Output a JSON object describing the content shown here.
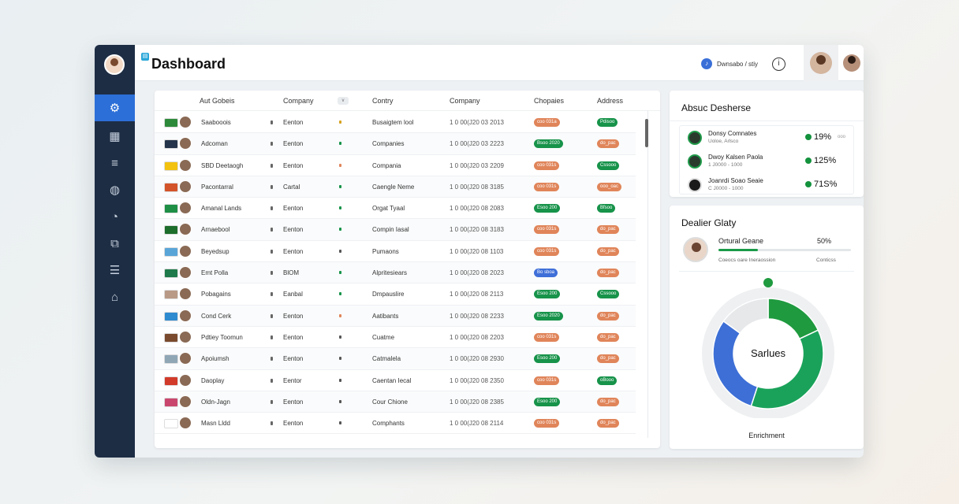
{
  "window": {
    "title": "Dashboard"
  },
  "topbar": {
    "user_label": "Dwnsabo / stiy",
    "info_glyph": "i"
  },
  "sidebar": {
    "items": [
      {
        "icon": "gear-icon",
        "glyph": "⚙",
        "active": true
      },
      {
        "icon": "building-icon",
        "glyph": "▦"
      },
      {
        "icon": "menu-icon",
        "glyph": "≡"
      },
      {
        "icon": "globe-icon",
        "glyph": "◍"
      },
      {
        "icon": "clock-icon",
        "glyph": "◔"
      },
      {
        "icon": "users-icon",
        "glyph": "⧉"
      },
      {
        "icon": "list-icon",
        "glyph": "☰"
      },
      {
        "icon": "home-icon",
        "glyph": "⌂"
      }
    ]
  },
  "table": {
    "headers": [
      "Aut Gobeis",
      "Company",
      "Contry",
      "Company",
      "Chopaies",
      "Address"
    ],
    "header_chip": "v",
    "rows": [
      {
        "name": "Saabooois",
        "company": "Eenton",
        "country": "Busaigtem lool",
        "phone": "1 0 00(J20 03 2013",
        "p1": "coo 031a",
        "p1c": "#e0855a",
        "p2": "Pdisoo",
        "p2c": "#17934a",
        "thumb": "#2d8a3a",
        "dot": "#d6a21f"
      },
      {
        "name": "Adcoman",
        "company": "Eenton",
        "country": "Companies",
        "phone": "1 0 00(J20 03 2223",
        "p1": "Bsoo 2020",
        "p1c": "#17934a",
        "p2": "do_pac",
        "p2c": "#e0855a",
        "thumb": "#24344a",
        "dot": "#17934a"
      },
      {
        "name": "SBD Deetaogh",
        "company": "Eenton",
        "country": "Compania",
        "phone": "1 0 00(J20 03 2209",
        "p1": "coo 031s",
        "p1c": "#e0855a",
        "p2": "Cssooo",
        "p2c": "#17934a",
        "thumb": "#f2c20f",
        "dot": "#e0855a"
      },
      {
        "name": "Pacontarral",
        "company": "Cartal",
        "country": "Caengle Neme",
        "phone": "1 0 00(J20 08 3185",
        "p1": "coo 031s",
        "p1c": "#e0855a",
        "p2": "ooo_oac",
        "p2c": "#e0855a",
        "thumb": "#d3542a",
        "dot": "#17934a"
      },
      {
        "name": "Amanal Lands",
        "company": "Eenton",
        "country": "Orgat Tyaal",
        "phone": "1 0 00(J20 08 2083",
        "p1": "Esoo 200",
        "p1c": "#17934a",
        "p2": "Bfsoo",
        "p2c": "#17934a",
        "thumb": "#1e8f45",
        "dot": "#17934a"
      },
      {
        "name": "Arnaebool",
        "company": "Eenton",
        "country": "Compin Iasal",
        "phone": "1 0 00(J20 08 3183",
        "p1": "coo 031s",
        "p1c": "#e0855a",
        "p2": "do_pac",
        "p2c": "#e0855a",
        "thumb": "#1d6d2c",
        "dot": "#17934a"
      },
      {
        "name": "Beyedsup",
        "company": "Eenton",
        "country": "Pumaons",
        "phone": "1 0 00(J20 08 1103",
        "p1": "coo 031s",
        "p1c": "#e0855a",
        "p2": "do_pac",
        "p2c": "#e0855a",
        "thumb": "#5aa5d8",
        "dot": "#555555"
      },
      {
        "name": "Emt Polla",
        "company": "BlOM",
        "country": "Alpritesiears",
        "phone": "1 0 00(J20 08 2023",
        "p1": "Bo sboa",
        "p1c": "#3f6fd8",
        "p2": "do_pac",
        "p2c": "#e0855a",
        "thumb": "#1e7a4a",
        "dot": "#17934a"
      },
      {
        "name": "Pobagains",
        "company": "Eanbal",
        "country": "Dmpauslire",
        "phone": "1 0 00(J20 08 2113",
        "p1": "Esoo 200",
        "p1c": "#17934a",
        "p2": "Cssooo",
        "p2c": "#17934a",
        "thumb": "#b89a86",
        "dot": "#17934a"
      },
      {
        "name": "Cond Cerk",
        "company": "Eenton",
        "country": "Aatibants",
        "phone": "1 0 00(J20 08 2233",
        "p1": "Esoo 2020",
        "p1c": "#17934a",
        "p2": "do_pac",
        "p2c": "#e0855a",
        "thumb": "#2e8bd0",
        "dot": "#e0855a"
      },
      {
        "name": "Pdtiey Toomun",
        "company": "Eenton",
        "country": "Cuatme",
        "phone": "1 0 00(J20 08 2203",
        "p1": "coo 031s",
        "p1c": "#e0855a",
        "p2": "do_pac",
        "p2c": "#e0855a",
        "thumb": "#7a4a2e",
        "dot": "#555555"
      },
      {
        "name": "Apoiumsh",
        "company": "Eenton",
        "country": "Catmalela",
        "phone": "1 0 00(J20 08 2930",
        "p1": "Esoo 200",
        "p1c": "#17934a",
        "p2": "do_pac",
        "p2c": "#e0855a",
        "thumb": "#8fa6b5",
        "dot": "#555555"
      },
      {
        "name": "Daoplay",
        "company": "Eentor",
        "country": "Caentan Iecal",
        "phone": "1 0 00(J20 08 2350",
        "p1": "coo 031s",
        "p1c": "#e0855a",
        "p2": "oBooo",
        "p2c": "#17934a",
        "thumb": "#d23a2a",
        "dot": "#555555"
      },
      {
        "name": "Oldn-Jagn",
        "company": "Eenton",
        "country": "Cour Chione",
        "phone": "1 0 00(J20 08 2385",
        "p1": "Esoo 200",
        "p1c": "#17934a",
        "p2": "do_pac",
        "p2c": "#e0855a",
        "thumb": "#c9476e",
        "dot": "#555555"
      },
      {
        "name": "Masn Lldd",
        "company": "Eenton",
        "country": "Comphants",
        "phone": "1 0 00(J20 08 2114",
        "p1": "coo 031s",
        "p1c": "#e0855a",
        "p2": "do_pac",
        "p2c": "#e0855a",
        "thumb": "#ffffff",
        "dot": "#555555"
      }
    ]
  },
  "card1": {
    "title": "Absuc Desherse",
    "items": [
      {
        "name": "Donsy Comnates",
        "sub": "Uoloe, Arlsco",
        "value": "19%",
        "trend": "ooo"
      },
      {
        "name": "Dwoy Kalsen Paola",
        "sub": "1 J0000 - 1000",
        "value": "125%",
        "trend": ""
      },
      {
        "name": "Joanrdi Soao Seaie",
        "sub": "C J0000 - 1000",
        "value": "71S%",
        "trend": ""
      }
    ]
  },
  "card2": {
    "title": "Dealier Glaty",
    "person_name": "Ortural Geane",
    "percent": "50%",
    "progress": 0.3,
    "sub_left": "Coeocs oare Ineraossion",
    "sub_right": "Conticss",
    "donut_center": "Sarlues",
    "caption": "Enrichment",
    "donut_segments": [
      {
        "value": 0.18,
        "color": "#1f9a3f"
      },
      {
        "value": 0.37,
        "color": "#1aa25a"
      },
      {
        "value": 0.3,
        "color": "#3d6fd6"
      },
      {
        "value": 0.15,
        "color": "#e6e8ea"
      }
    ]
  }
}
